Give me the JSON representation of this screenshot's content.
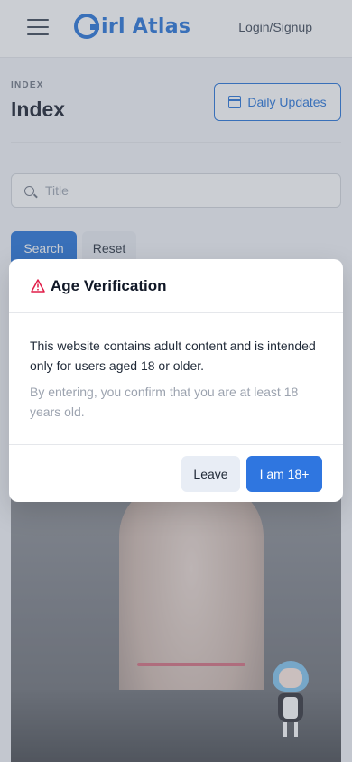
{
  "header": {
    "logo_text": "irl Atlas",
    "login_label": "Login/Signup"
  },
  "page": {
    "kicker": "INDEX",
    "title": "Index",
    "daily_updates_label": "Daily Updates"
  },
  "search": {
    "placeholder": "Title",
    "value": "",
    "search_label": "Search",
    "reset_label": "Reset"
  },
  "modal": {
    "title": "Age Verification",
    "body": "This website contains adult content and is intended only for users aged 18 or older.",
    "note": "By entering, you confirm that you are at least 18 years old.",
    "leave_label": "Leave",
    "confirm_label": "I am 18+"
  },
  "colors": {
    "brand": "#1f6fd8",
    "primary_button": "#2f76e0",
    "warning_icon": "#e11d48",
    "overlay": "rgba(107,114,128,0.35)"
  },
  "icons": [
    "menu-icon",
    "calendar-icon",
    "search-icon",
    "warning-icon"
  ]
}
